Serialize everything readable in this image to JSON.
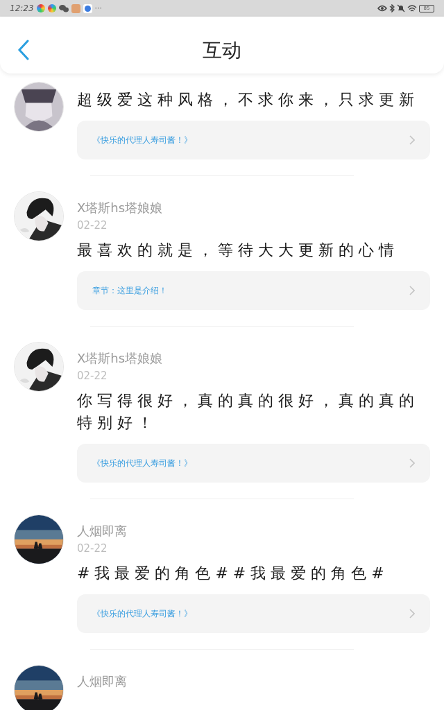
{
  "status_bar": {
    "time": "12:23",
    "more": "···",
    "battery": "85"
  },
  "header": {
    "title": "互动"
  },
  "comments": [
    {
      "text": "超级爱这种风格，不求你来，只求更新",
      "link": "《快乐的代理人寿司酱！》"
    },
    {
      "name": "X塔斯hs塔娘娘",
      "date": "02-22",
      "text": "最喜欢的就是，等待大大更新的心情",
      "link": "章节：这里是介绍！"
    },
    {
      "name": "X塔斯hs塔娘娘",
      "date": "02-22",
      "text": "你写得很好，真的真的很好，真的真的特别好！",
      "link": "《快乐的代理人寿司酱！》"
    },
    {
      "name": "人烟即离",
      "date": "02-22",
      "text": "#我最爱的角色##我最爱的角色#",
      "link": "《快乐的代理人寿司酱！》"
    },
    {
      "name": "人烟即离"
    }
  ]
}
